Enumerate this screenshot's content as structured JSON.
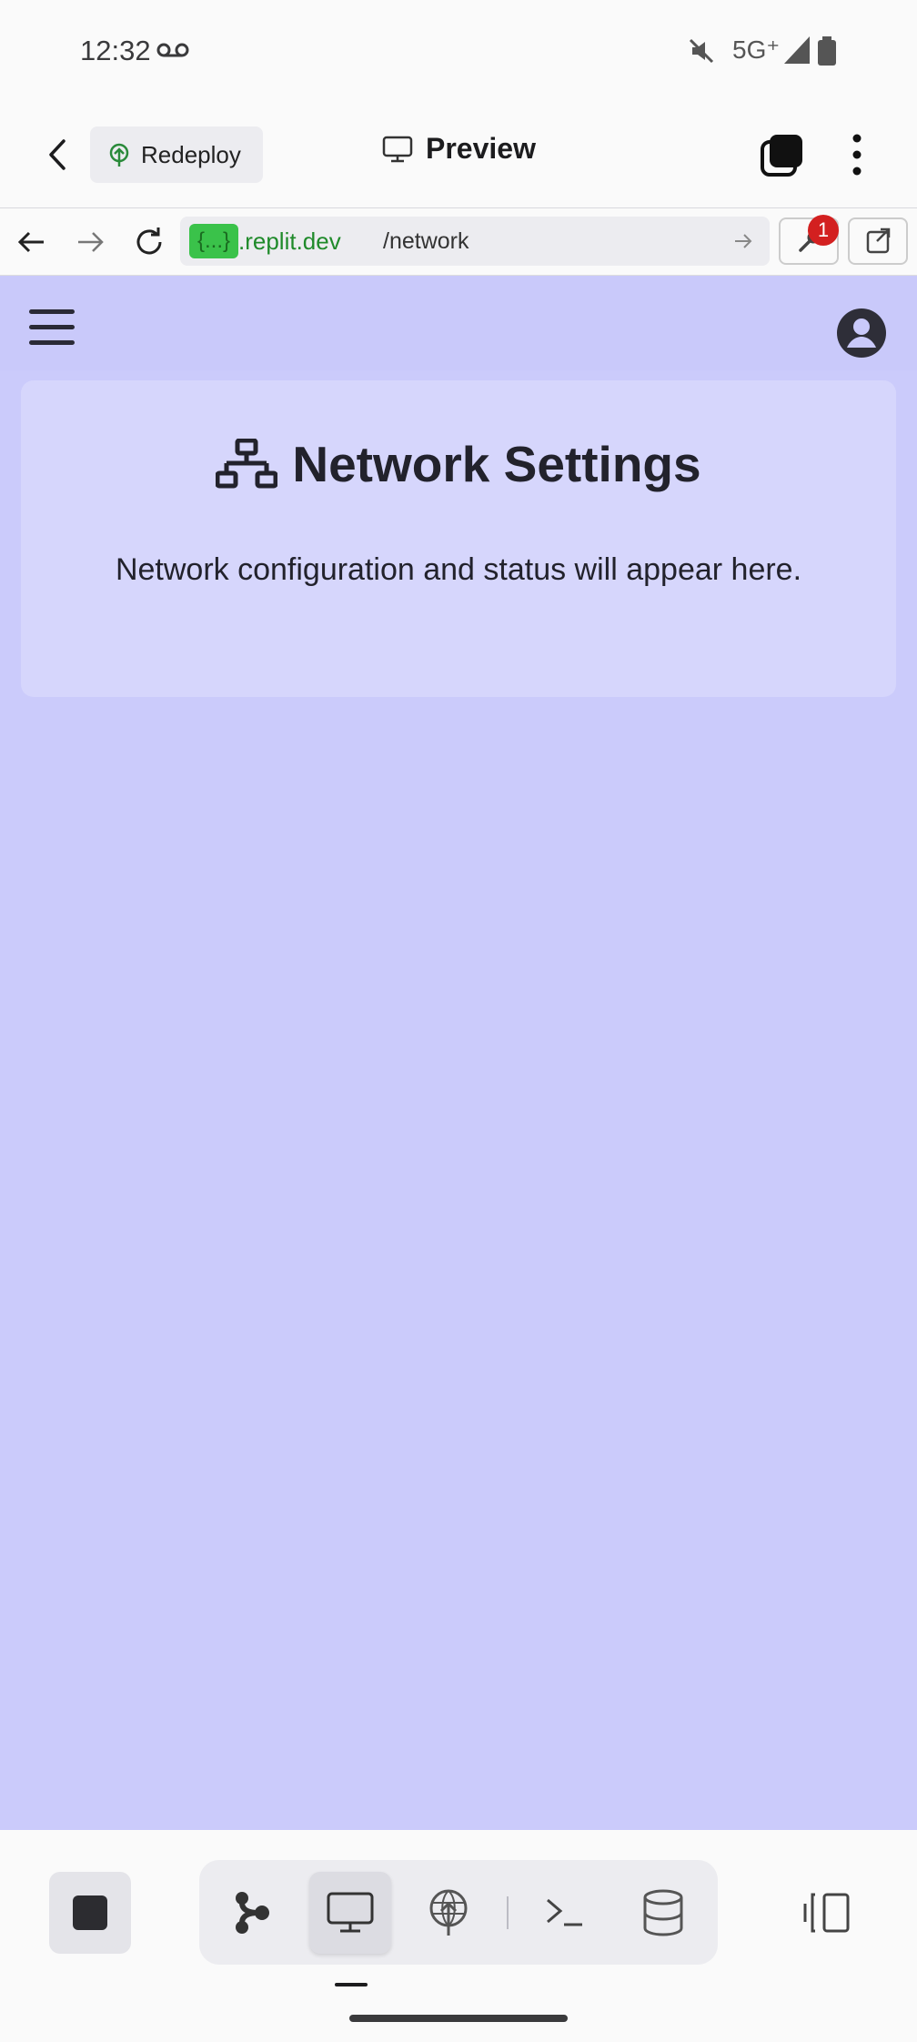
{
  "status_bar": {
    "time": "12:32",
    "network": "5G⁺",
    "icons": [
      "voicemail-icon",
      "mute-icon",
      "signal-icon",
      "battery-icon"
    ]
  },
  "header": {
    "redeploy_label": "Redeploy",
    "title": "Preview"
  },
  "url_bar": {
    "badge": "{...}",
    "domain": ".replit.dev",
    "path": "/network",
    "devtools_badge_count": "1"
  },
  "page": {
    "card_title": "Network Settings",
    "card_text": "Network configuration and status will appear here."
  },
  "colors": {
    "page_background": "#cbcbfb",
    "card_background": "#d6d6fc",
    "url_badge": "#3ac24a",
    "notification": "#d32020"
  },
  "toolbar": {
    "tools": [
      "stop-icon",
      "agent-icon",
      "preview-icon",
      "deploy-icon",
      "shell-icon",
      "database-icon",
      "split-view-icon"
    ],
    "active_tool": "preview"
  }
}
